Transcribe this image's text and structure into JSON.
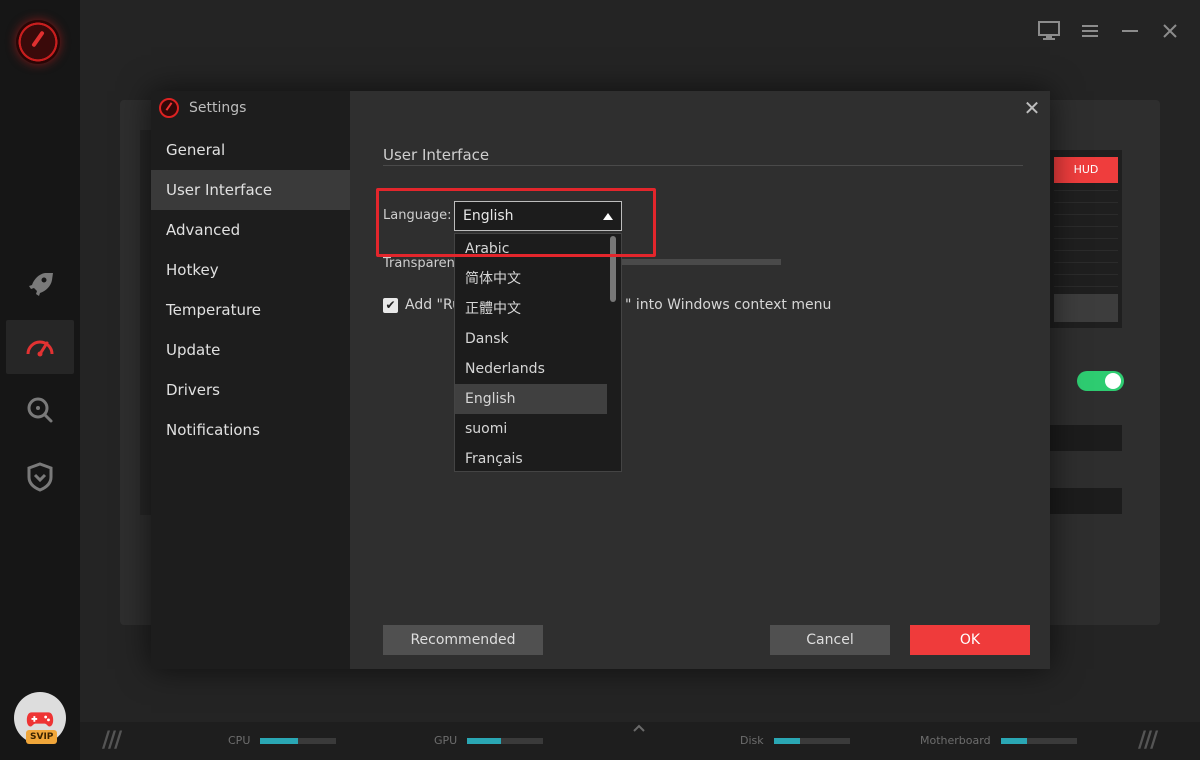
{
  "dialog": {
    "title": "Settings",
    "close_glyph": "✕",
    "nav": [
      {
        "label": "General"
      },
      {
        "label": "User Interface"
      },
      {
        "label": "Advanced"
      },
      {
        "label": "Hotkey"
      },
      {
        "label": "Temperature"
      },
      {
        "label": "Update"
      },
      {
        "label": "Drivers"
      },
      {
        "label": "Notifications"
      }
    ],
    "active_nav": "User Interface",
    "section_title": "User Interface",
    "language": {
      "label": "Language:",
      "selected": "English",
      "options": [
        {
          "label": "Arabic"
        },
        {
          "label": "简体中文"
        },
        {
          "label": "正體中文"
        },
        {
          "label": "Dansk"
        },
        {
          "label": "Nederlands"
        },
        {
          "label": "English"
        },
        {
          "label": "suomi"
        },
        {
          "label": "Français"
        }
      ]
    },
    "transparency_label": "Transparency",
    "context_menu": {
      "checked": true,
      "text_before": "Add \"Ru",
      "text_after": "\" into Windows context menu",
      "check_glyph": "✔"
    },
    "buttons": {
      "recommended": "Recommended",
      "cancel": "Cancel",
      "ok": "OK"
    }
  },
  "background": {
    "hud_label": "HUD"
  },
  "statusbar": {
    "cpu_label": "CPU",
    "gpu_label": "GPU",
    "disk_label": "Disk",
    "motherboard_label": "Motherboard",
    "cpu_level": 0.5,
    "gpu_level": 0.45,
    "disk_level": 0.35,
    "motherboard_level": 0.35,
    "slashes": "///"
  },
  "sidebar": {
    "svip_label": "SVIP"
  },
  "colors": {
    "accent": "#ef3b3b",
    "highlight": "#e3262c",
    "toggle_on": "#2ecc71",
    "meter": "#2aa7b4"
  },
  "icons": [
    "app-logo-icon",
    "rocket-icon",
    "speedometer-icon",
    "search-scan-icon",
    "shield-icon",
    "gamepad-icon",
    "monitor-icon",
    "menu-icon",
    "minimize-icon",
    "close-icon",
    "caret-up-icon",
    "chevron-up-icon"
  ]
}
